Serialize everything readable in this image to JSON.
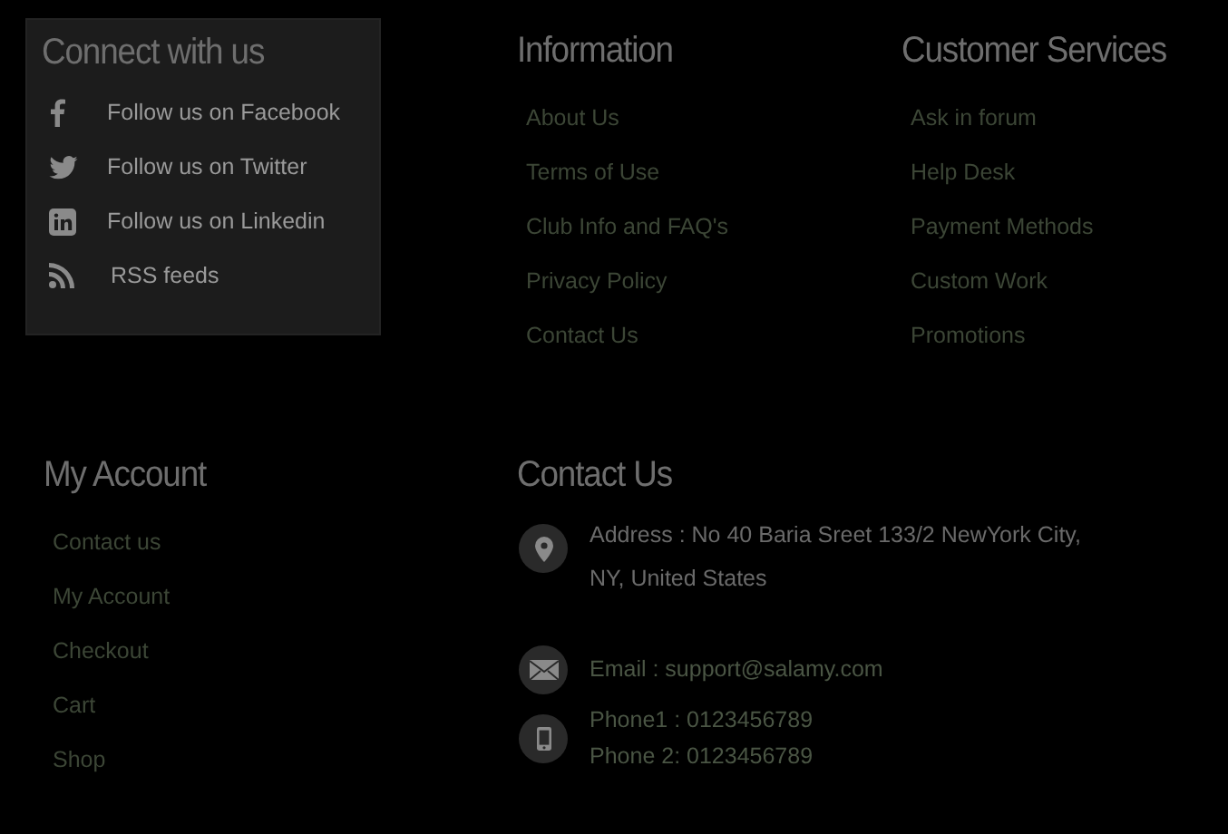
{
  "connect": {
    "title": "Connect with us",
    "items": [
      {
        "kind": "facebook",
        "label": "Follow us on Facebook"
      },
      {
        "kind": "twitter",
        "label": "Follow us on Twitter"
      },
      {
        "kind": "linkedin",
        "label": "Follow us on Linkedin"
      },
      {
        "kind": "rss",
        "label": "RSS feeds"
      }
    ]
  },
  "information": {
    "title": "Information",
    "links": [
      "About Us",
      "Terms of Use",
      "Club Info and FAQ's",
      "Privacy Policy",
      "Contact Us"
    ]
  },
  "customer_services": {
    "title": "Customer Services",
    "links": [
      "Ask in forum",
      "Help Desk",
      "Payment Methods",
      "Custom Work",
      "Promotions"
    ]
  },
  "my_account": {
    "title": "My Account",
    "links": [
      "Contact us",
      "My Account",
      "Checkout",
      "Cart",
      "Shop"
    ]
  },
  "contact_us": {
    "title": "Contact Us",
    "items": [
      {
        "kind": "address",
        "lines": [
          "Address : No 40 Baria Sreet 133/2 NewYork City, NY, United States"
        ]
      },
      {
        "kind": "email",
        "lines": [
          "Email : support@salamy.com"
        ]
      },
      {
        "kind": "phone",
        "lines": [
          "Phone1 : 0123456789",
          "Phone 2: 0123456789"
        ]
      }
    ]
  }
}
